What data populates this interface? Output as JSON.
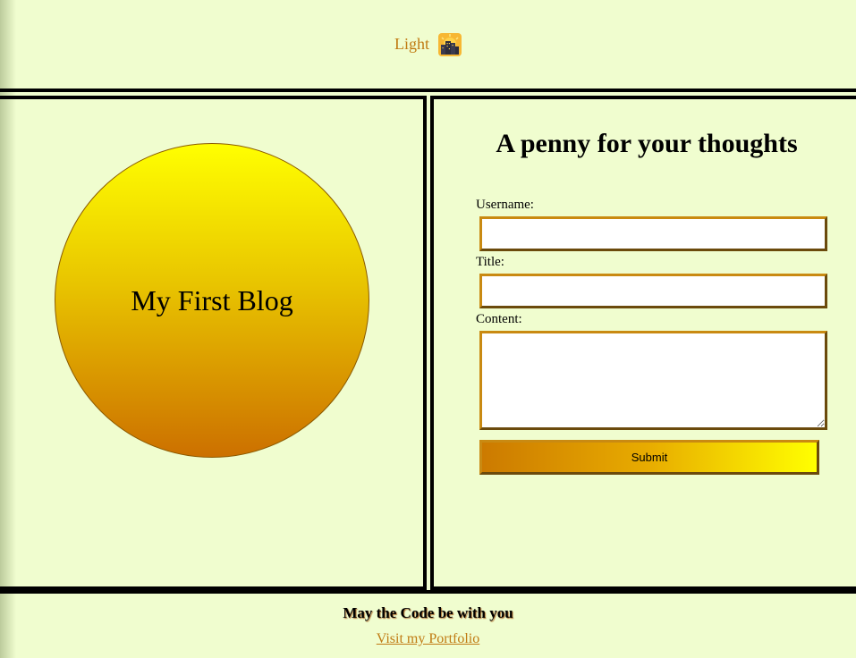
{
  "theme_toggle": {
    "label": "Light",
    "icon": "sunrise-city-icon"
  },
  "blog": {
    "title": "My First Blog"
  },
  "form": {
    "heading": "A penny for your thoughts",
    "username_label": "Username:",
    "username_value": "",
    "title_label": "Title:",
    "title_value": "",
    "content_label": "Content:",
    "content_value": "",
    "submit_label": "Submit"
  },
  "footer": {
    "tagline": "May the Code be with you",
    "link_text": "Visit my Portfolio"
  },
  "colors": {
    "page_background": "#f0fdcf",
    "accent": "#c07a12",
    "gradient_yellow": "#ffff00",
    "gradient_orange": "#cc7000"
  }
}
